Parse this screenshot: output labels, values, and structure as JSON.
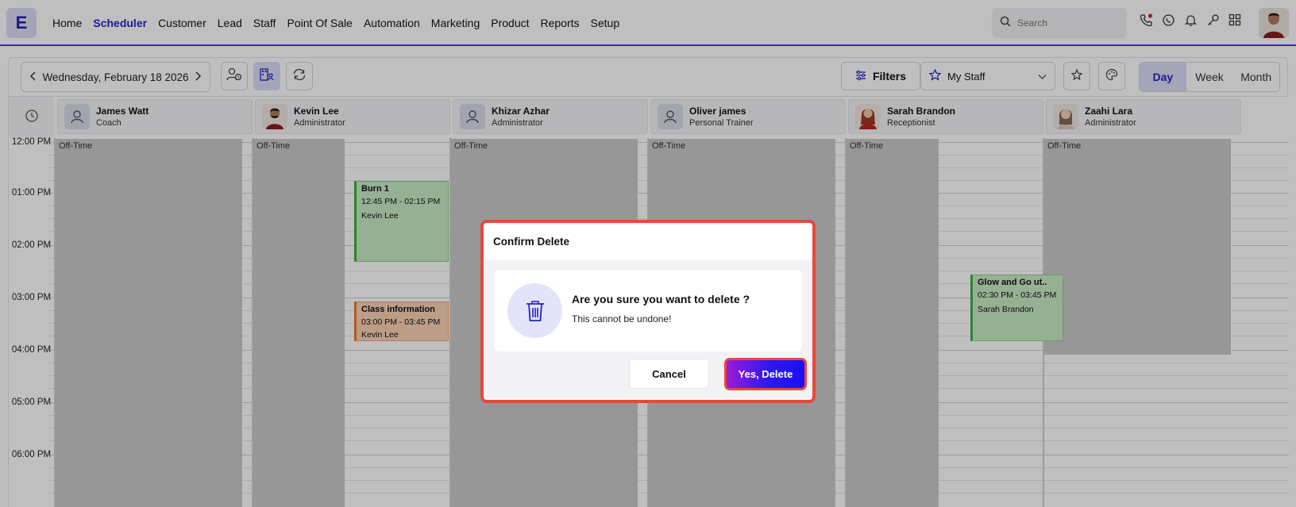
{
  "app": {
    "logo_letter": "E"
  },
  "nav": {
    "items": [
      {
        "label": "Home",
        "active": false
      },
      {
        "label": "Scheduler",
        "active": true
      },
      {
        "label": "Customer",
        "active": false
      },
      {
        "label": "Lead",
        "active": false
      },
      {
        "label": "Staff",
        "active": false
      },
      {
        "label": "Point Of Sale",
        "active": false
      },
      {
        "label": "Automation",
        "active": false
      },
      {
        "label": "Marketing",
        "active": false
      },
      {
        "label": "Product",
        "active": false
      },
      {
        "label": "Reports",
        "active": false
      },
      {
        "label": "Setup",
        "active": false
      }
    ],
    "search_placeholder": "Search"
  },
  "toolbar": {
    "date": "Wednesday, February 18 2026",
    "filters_label": "Filters",
    "staff_select": "My Staff",
    "views": [
      {
        "label": "Day",
        "active": true
      },
      {
        "label": "Week",
        "active": false
      },
      {
        "label": "Month",
        "active": false
      }
    ]
  },
  "calendar": {
    "times": [
      "12:00 PM",
      "01:00 PM",
      "02:00 PM",
      "03:00 PM",
      "04:00 PM",
      "05:00 PM",
      "06:00 PM"
    ],
    "staff": [
      {
        "name": "James Watt",
        "role": "Coach",
        "photo": false
      },
      {
        "name": "Kevin Lee",
        "role": "Administrator",
        "photo": true
      },
      {
        "name": "Khizar Azhar",
        "role": "Administrator",
        "photo": false
      },
      {
        "name": "Oliver james",
        "role": "Personal Trainer",
        "photo": false
      },
      {
        "name": "Sarah Brandon",
        "role": "Receptionist",
        "photo": true
      },
      {
        "name": "Zaahi Lara",
        "role": "Administrator",
        "photo": true
      }
    ],
    "offtime_label": "Off-Time",
    "events": [
      {
        "title": "Burn 1",
        "time": "12:45 PM - 02:15 PM",
        "staff": "Kevin Lee"
      },
      {
        "title": "Class information",
        "time": "03:00 PM - 03:45 PM",
        "staff": "Kevin Lee"
      },
      {
        "title": "Glow and Go  ut..",
        "time": "02:30 PM - 03:45 PM",
        "staff": "Sarah Brandon"
      }
    ]
  },
  "modal": {
    "title": "Confirm Delete",
    "question": "Are you sure you want to delete ?",
    "subtext": "This cannot be undone!",
    "cancel_label": "Cancel",
    "confirm_label": "Yes, Delete"
  }
}
